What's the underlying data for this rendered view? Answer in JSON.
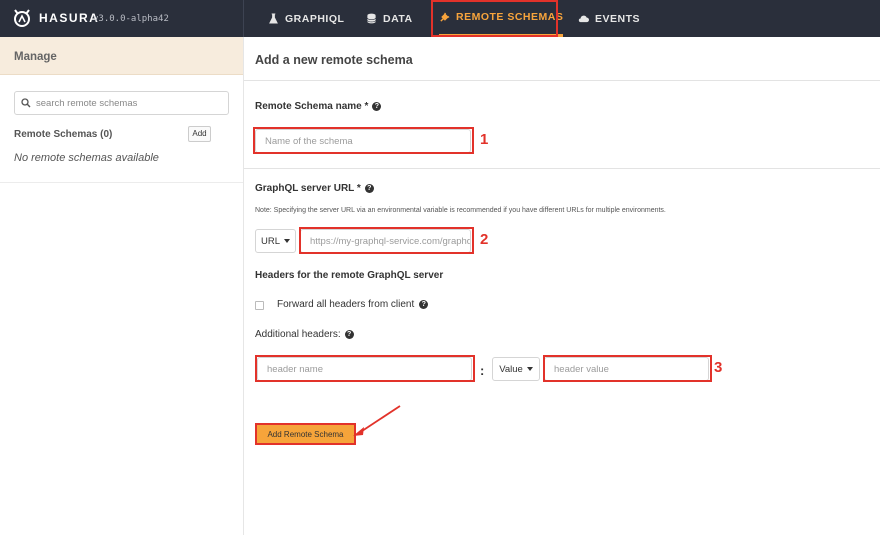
{
  "brand": {
    "name": "HASURA",
    "version": "v3.0.0-alpha42",
    "logo_icon": "hasura-logo-icon"
  },
  "nav": {
    "items": [
      {
        "label": "GRAPHIQL",
        "icon": "flask-icon",
        "active": false
      },
      {
        "label": "DATA",
        "icon": "database-icon",
        "active": false
      },
      {
        "label": "REMOTE SCHEMAS",
        "icon": "plug-icon",
        "active": true
      },
      {
        "label": "EVENTS",
        "icon": "cloud-icon",
        "active": false
      }
    ]
  },
  "sidebar": {
    "header": "Manage",
    "search_placeholder": "search remote schemas",
    "list_title": "Remote Schemas (0)",
    "add_label": "Add",
    "empty_text": "No remote schemas available"
  },
  "main": {
    "title": "Add a new remote schema",
    "schema_name": {
      "label": "Remote Schema name *",
      "placeholder": "Name of the schema",
      "annotation": "1"
    },
    "server_url": {
      "label": "GraphQL server URL *",
      "note": "Note: Specifying the server URL via an environmental variable is recommended if you have different URLs for multiple environments.",
      "type_select": "URL",
      "placeholder": "https://my-graphql-service.com/graphql",
      "annotation": "2"
    },
    "headers": {
      "title": "Headers for the remote GraphQL server",
      "forward_label": "Forward all headers from client",
      "additional_label": "Additional headers:",
      "name_placeholder": "header name",
      "separator": ":",
      "value_type": "Value",
      "value_placeholder": "header value",
      "annotation": "3"
    },
    "submit_label": "Add Remote Schema"
  },
  "colors": {
    "topbar": "#2a2f3b",
    "accent": "#f8a43c",
    "annotation": "#e2322a",
    "sidebar_header": "#f7ecdd"
  }
}
